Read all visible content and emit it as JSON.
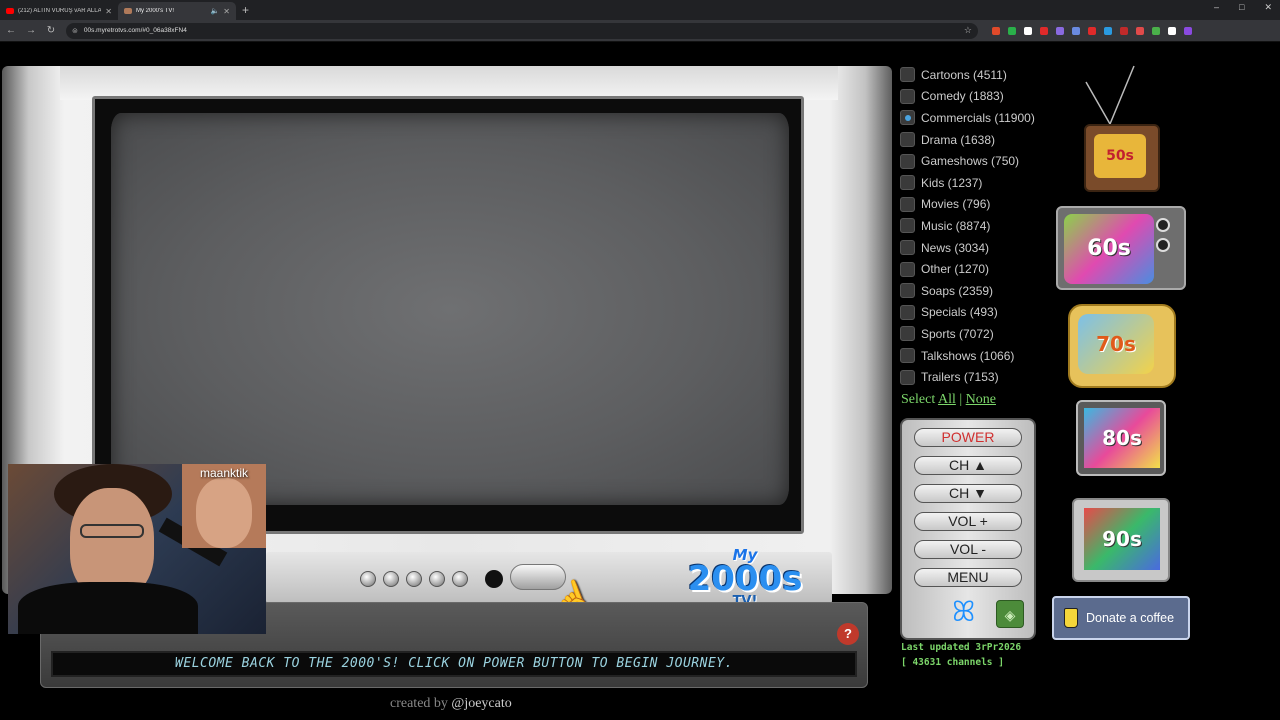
{
  "browser": {
    "tabs": [
      {
        "title": "(212) ALTIN VURUŞ vAR ALLAH",
        "color": "#ff0000"
      },
      {
        "title": "My 2000's TV!",
        "color": "#b07a5a"
      }
    ],
    "new_tab": "+",
    "url": "00s.myretrotvs.com/#0_06a38xFN4",
    "window_controls": [
      "–",
      "□",
      "✕"
    ],
    "nav": {
      "back": "←",
      "forward": "→",
      "reload": "↻"
    },
    "extension_colors": [
      "#e04a2a",
      "#2ab04a",
      "#ffffff",
      "#e02a2a",
      "#8a6ae0",
      "#6a8ae0",
      "#e02a2a",
      "#2a9ae0",
      "#c02a2a",
      "#e04a4a",
      "#4ab04a",
      "#ffffff",
      "#8a4ae0"
    ]
  },
  "tv": {
    "welcome_text": "WELCOME BACK TO THE 2000'S! CLICK ON POWER BUTTON TO BEGIN JOURNEY.",
    "help_label": "?",
    "logo": {
      "my": "My",
      "decade": "2000s",
      "tv": "TV!"
    }
  },
  "credit": {
    "prefix": "created by",
    "handle": "@joeycato"
  },
  "webcam": {
    "inset_label": "maanktik"
  },
  "categories": [
    {
      "label": "Cartoons (4511)",
      "checked": false
    },
    {
      "label": "Comedy (1883)",
      "checked": false
    },
    {
      "label": "Commercials (11900)",
      "checked": true
    },
    {
      "label": "Drama (1638)",
      "checked": false
    },
    {
      "label": "Gameshows (750)",
      "checked": false
    },
    {
      "label": "Kids (1237)",
      "checked": false
    },
    {
      "label": "Movies (796)",
      "checked": false
    },
    {
      "label": "Music (8874)",
      "checked": false
    },
    {
      "label": "News (3034)",
      "checked": false
    },
    {
      "label": "Other (1270)",
      "checked": false
    },
    {
      "label": "Soaps (2359)",
      "checked": false
    },
    {
      "label": "Specials (493)",
      "checked": false
    },
    {
      "label": "Sports (7072)",
      "checked": false
    },
    {
      "label": "Talkshows (1066)",
      "checked": false
    },
    {
      "label": "Trailers (7153)",
      "checked": false
    }
  ],
  "select": {
    "prefix": "Select",
    "all": "All",
    "sep": "|",
    "none": "None"
  },
  "remote": {
    "power": "POWER",
    "ch_up": "CH ▲",
    "ch_down": "CH ▼",
    "vol_up": "VOL +",
    "vol_down": "VOL -",
    "menu": "MENU"
  },
  "last_updated": {
    "line1": "Last updated 3rPr2026",
    "line2": "[ 43631 channels ]"
  },
  "decades": {
    "d50": "50s",
    "d60": "60s",
    "d70": "70s",
    "d80": "80s",
    "d90": "90s",
    "my": "MY",
    "tv": "TV!"
  },
  "donate": {
    "label": "Donate a coffee"
  }
}
